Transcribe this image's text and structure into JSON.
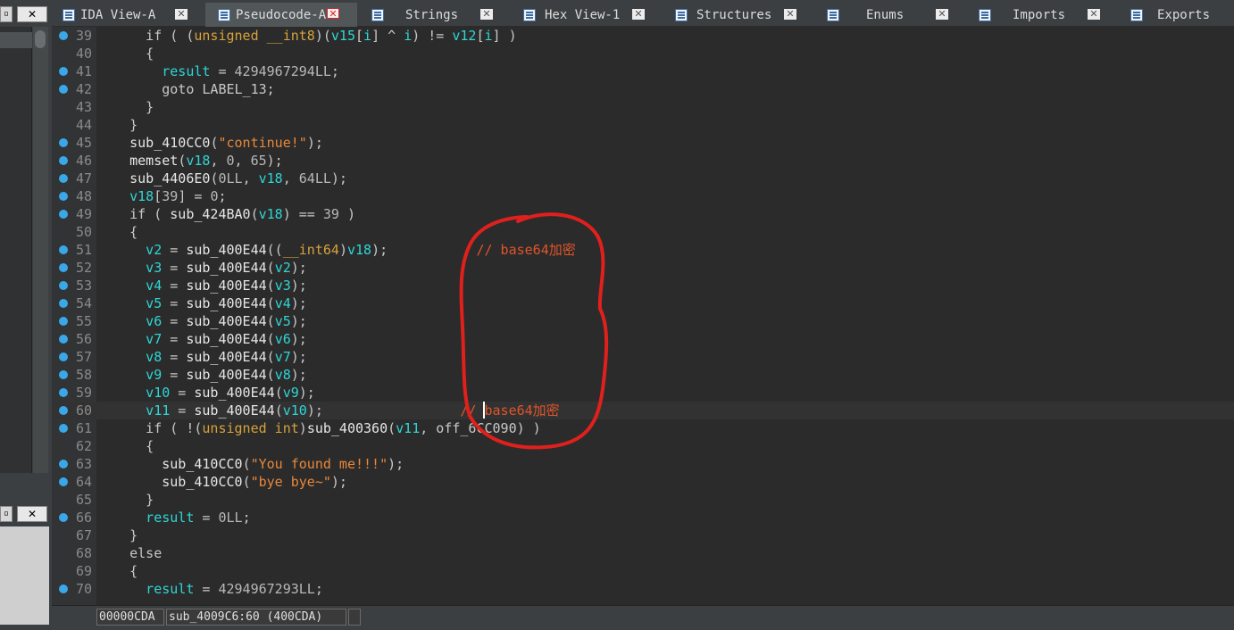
{
  "tabs": [
    {
      "label": "IDA View-A",
      "icon": "ida-view-icon",
      "active": false
    },
    {
      "label": "Pseudocode-A",
      "icon": "pseudocode-icon",
      "active": true
    },
    {
      "label": "Strings",
      "icon": "strings-icon",
      "active": false
    },
    {
      "label": "Hex View-1",
      "icon": "hex-view-icon",
      "active": false
    },
    {
      "label": "Structures",
      "icon": "structures-icon",
      "active": false
    },
    {
      "label": "Enums",
      "icon": "enums-icon",
      "active": false
    },
    {
      "label": "Imports",
      "icon": "imports-icon",
      "active": false
    },
    {
      "label": "Exports",
      "icon": "exports-icon",
      "active": false
    }
  ],
  "tab_close_glyph": "✕",
  "left_buttons": {
    "close_top": "✕",
    "close_bottom": "✕"
  },
  "code": {
    "lines": [
      {
        "n": "39",
        "bp": true,
        "tokens": [
          [
            "t-op",
            "      if ( ("
          ],
          [
            "t-kw",
            "unsigned __int8"
          ],
          [
            "t-op",
            ")("
          ],
          [
            "t-var",
            "v15"
          ],
          [
            "t-op",
            "["
          ],
          [
            "t-var",
            "i"
          ],
          [
            "t-op",
            "] ^ "
          ],
          [
            "t-var",
            "i"
          ],
          [
            "t-op",
            ") != "
          ],
          [
            "t-var",
            "v12"
          ],
          [
            "t-op",
            "["
          ],
          [
            "t-var",
            "i"
          ],
          [
            "t-op",
            "] )"
          ]
        ]
      },
      {
        "n": "40",
        "bp": false,
        "tokens": [
          [
            "t-op",
            "      {"
          ]
        ]
      },
      {
        "n": "41",
        "bp": true,
        "tokens": [
          [
            "t-var",
            "        result"
          ],
          [
            "t-op",
            " = "
          ],
          [
            "t-num",
            "4294967294LL"
          ],
          [
            "t-op",
            ";"
          ]
        ]
      },
      {
        "n": "42",
        "bp": true,
        "tokens": [
          [
            "t-op",
            "        goto LABEL_13;"
          ]
        ]
      },
      {
        "n": "43",
        "bp": false,
        "tokens": [
          [
            "t-op",
            "      }"
          ]
        ]
      },
      {
        "n": "44",
        "bp": false,
        "tokens": [
          [
            "t-op",
            "    }"
          ]
        ]
      },
      {
        "n": "45",
        "bp": true,
        "tokens": [
          [
            "t-fn",
            "    sub_410CC0"
          ],
          [
            "t-op",
            "("
          ],
          [
            "t-str",
            "\"continue!\""
          ],
          [
            "t-op",
            ");"
          ]
        ]
      },
      {
        "n": "46",
        "bp": true,
        "tokens": [
          [
            "t-fn",
            "    memset"
          ],
          [
            "t-op",
            "("
          ],
          [
            "t-var",
            "v18"
          ],
          [
            "t-op",
            ", "
          ],
          [
            "t-num",
            "0"
          ],
          [
            "t-op",
            ", "
          ],
          [
            "t-num",
            "65"
          ],
          [
            "t-op",
            ");"
          ]
        ]
      },
      {
        "n": "47",
        "bp": true,
        "tokens": [
          [
            "t-fn",
            "    sub_4406E0"
          ],
          [
            "t-op",
            "("
          ],
          [
            "t-num",
            "0LL"
          ],
          [
            "t-op",
            ", "
          ],
          [
            "t-var",
            "v18"
          ],
          [
            "t-op",
            ", "
          ],
          [
            "t-num",
            "64LL"
          ],
          [
            "t-op",
            ");"
          ]
        ]
      },
      {
        "n": "48",
        "bp": true,
        "tokens": [
          [
            "t-var",
            "    v18"
          ],
          [
            "t-op",
            "["
          ],
          [
            "t-num",
            "39"
          ],
          [
            "t-op",
            "] = "
          ],
          [
            "t-num",
            "0"
          ],
          [
            "t-op",
            ";"
          ]
        ]
      },
      {
        "n": "49",
        "bp": true,
        "tokens": [
          [
            "t-op",
            "    if ( "
          ],
          [
            "t-fn",
            "sub_424BA0"
          ],
          [
            "t-op",
            "("
          ],
          [
            "t-var",
            "v18"
          ],
          [
            "t-op",
            ") == "
          ],
          [
            "t-num",
            "39"
          ],
          [
            "t-op",
            " )"
          ]
        ]
      },
      {
        "n": "50",
        "bp": false,
        "tokens": [
          [
            "t-op",
            "    {"
          ]
        ]
      },
      {
        "n": "51",
        "bp": true,
        "tokens": [
          [
            "t-var",
            "      v2"
          ],
          [
            "t-op",
            " = "
          ],
          [
            "t-fn",
            "sub_400E44"
          ],
          [
            "t-op",
            "(("
          ],
          [
            "t-kw",
            "__int64"
          ],
          [
            "t-op",
            ")"
          ],
          [
            "t-var",
            "v18"
          ],
          [
            "t-op",
            ");           "
          ],
          [
            "t-cmt",
            "// base64加密"
          ]
        ]
      },
      {
        "n": "52",
        "bp": true,
        "tokens": [
          [
            "t-var",
            "      v3"
          ],
          [
            "t-op",
            " = "
          ],
          [
            "t-fn",
            "sub_400E44"
          ],
          [
            "t-op",
            "("
          ],
          [
            "t-var",
            "v2"
          ],
          [
            "t-op",
            ");"
          ]
        ]
      },
      {
        "n": "53",
        "bp": true,
        "tokens": [
          [
            "t-var",
            "      v4"
          ],
          [
            "t-op",
            " = "
          ],
          [
            "t-fn",
            "sub_400E44"
          ],
          [
            "t-op",
            "("
          ],
          [
            "t-var",
            "v3"
          ],
          [
            "t-op",
            ");"
          ]
        ]
      },
      {
        "n": "54",
        "bp": true,
        "tokens": [
          [
            "t-var",
            "      v5"
          ],
          [
            "t-op",
            " = "
          ],
          [
            "t-fn",
            "sub_400E44"
          ],
          [
            "t-op",
            "("
          ],
          [
            "t-var",
            "v4"
          ],
          [
            "t-op",
            ");"
          ]
        ]
      },
      {
        "n": "55",
        "bp": true,
        "tokens": [
          [
            "t-var",
            "      v6"
          ],
          [
            "t-op",
            " = "
          ],
          [
            "t-fn",
            "sub_400E44"
          ],
          [
            "t-op",
            "("
          ],
          [
            "t-var",
            "v5"
          ],
          [
            "t-op",
            ");"
          ]
        ]
      },
      {
        "n": "56",
        "bp": true,
        "tokens": [
          [
            "t-var",
            "      v7"
          ],
          [
            "t-op",
            " = "
          ],
          [
            "t-fn",
            "sub_400E44"
          ],
          [
            "t-op",
            "("
          ],
          [
            "t-var",
            "v6"
          ],
          [
            "t-op",
            ");"
          ]
        ]
      },
      {
        "n": "57",
        "bp": true,
        "tokens": [
          [
            "t-var",
            "      v8"
          ],
          [
            "t-op",
            " = "
          ],
          [
            "t-fn",
            "sub_400E44"
          ],
          [
            "t-op",
            "("
          ],
          [
            "t-var",
            "v7"
          ],
          [
            "t-op",
            ");"
          ]
        ]
      },
      {
        "n": "58",
        "bp": true,
        "tokens": [
          [
            "t-var",
            "      v9"
          ],
          [
            "t-op",
            " = "
          ],
          [
            "t-fn",
            "sub_400E44"
          ],
          [
            "t-op",
            "("
          ],
          [
            "t-var",
            "v8"
          ],
          [
            "t-op",
            ");"
          ]
        ]
      },
      {
        "n": "59",
        "bp": true,
        "tokens": [
          [
            "t-var",
            "      v10"
          ],
          [
            "t-op",
            " = "
          ],
          [
            "t-fn",
            "sub_400E44"
          ],
          [
            "t-op",
            "("
          ],
          [
            "t-var",
            "v9"
          ],
          [
            "t-op",
            ");"
          ]
        ]
      },
      {
        "n": "60",
        "bp": true,
        "current": true,
        "tokens": [
          [
            "t-var",
            "      v11"
          ],
          [
            "t-op",
            " = "
          ],
          [
            "t-fn",
            "sub_400E44"
          ],
          [
            "t-op",
            "("
          ],
          [
            "t-var",
            "v10"
          ],
          [
            "t-op",
            ");                 "
          ],
          [
            "t-cmt",
            "// base64加密"
          ]
        ]
      },
      {
        "n": "61",
        "bp": true,
        "tokens": [
          [
            "t-op",
            "      if ( !("
          ],
          [
            "t-kw",
            "unsigned int"
          ],
          [
            "t-op",
            ")"
          ],
          [
            "t-fn",
            "sub_400360"
          ],
          [
            "t-op",
            "("
          ],
          [
            "t-var",
            "v11"
          ],
          [
            "t-op",
            ", off_6CC090) )"
          ]
        ]
      },
      {
        "n": "62",
        "bp": false,
        "tokens": [
          [
            "t-op",
            "      {"
          ]
        ]
      },
      {
        "n": "63",
        "bp": true,
        "tokens": [
          [
            "t-fn",
            "        sub_410CC0"
          ],
          [
            "t-op",
            "("
          ],
          [
            "t-str",
            "\"You found me!!!\""
          ],
          [
            "t-op",
            ");"
          ]
        ]
      },
      {
        "n": "64",
        "bp": true,
        "tokens": [
          [
            "t-fn",
            "        sub_410CC0"
          ],
          [
            "t-op",
            "("
          ],
          [
            "t-str",
            "\"bye bye~\""
          ],
          [
            "t-op",
            ");"
          ]
        ]
      },
      {
        "n": "65",
        "bp": false,
        "tokens": [
          [
            "t-op",
            "      }"
          ]
        ]
      },
      {
        "n": "66",
        "bp": true,
        "tokens": [
          [
            "t-var",
            "      result"
          ],
          [
            "t-op",
            " = "
          ],
          [
            "t-num",
            "0LL"
          ],
          [
            "t-op",
            ";"
          ]
        ]
      },
      {
        "n": "67",
        "bp": false,
        "tokens": [
          [
            "t-op",
            "    }"
          ]
        ]
      },
      {
        "n": "68",
        "bp": false,
        "tokens": [
          [
            "t-op",
            "    else"
          ]
        ]
      },
      {
        "n": "69",
        "bp": false,
        "tokens": [
          [
            "t-op",
            "    {"
          ]
        ]
      },
      {
        "n": "70",
        "bp": true,
        "tokens": [
          [
            "t-var",
            "      result"
          ],
          [
            "t-op",
            " = "
          ],
          [
            "t-num",
            "4294967293LL"
          ],
          [
            "t-op",
            ";"
          ]
        ]
      }
    ]
  },
  "status": {
    "offset": "00000CDA",
    "location": "sub_4009C6:60 (400CDA)",
    "extra": ""
  },
  "colors": {
    "keyword": "#d6a23c",
    "variable": "#2fd6d6",
    "string": "#e8883a",
    "comment": "#e0552a",
    "breakpoint": "#3aa8e8",
    "annotation": "#e0201c"
  }
}
